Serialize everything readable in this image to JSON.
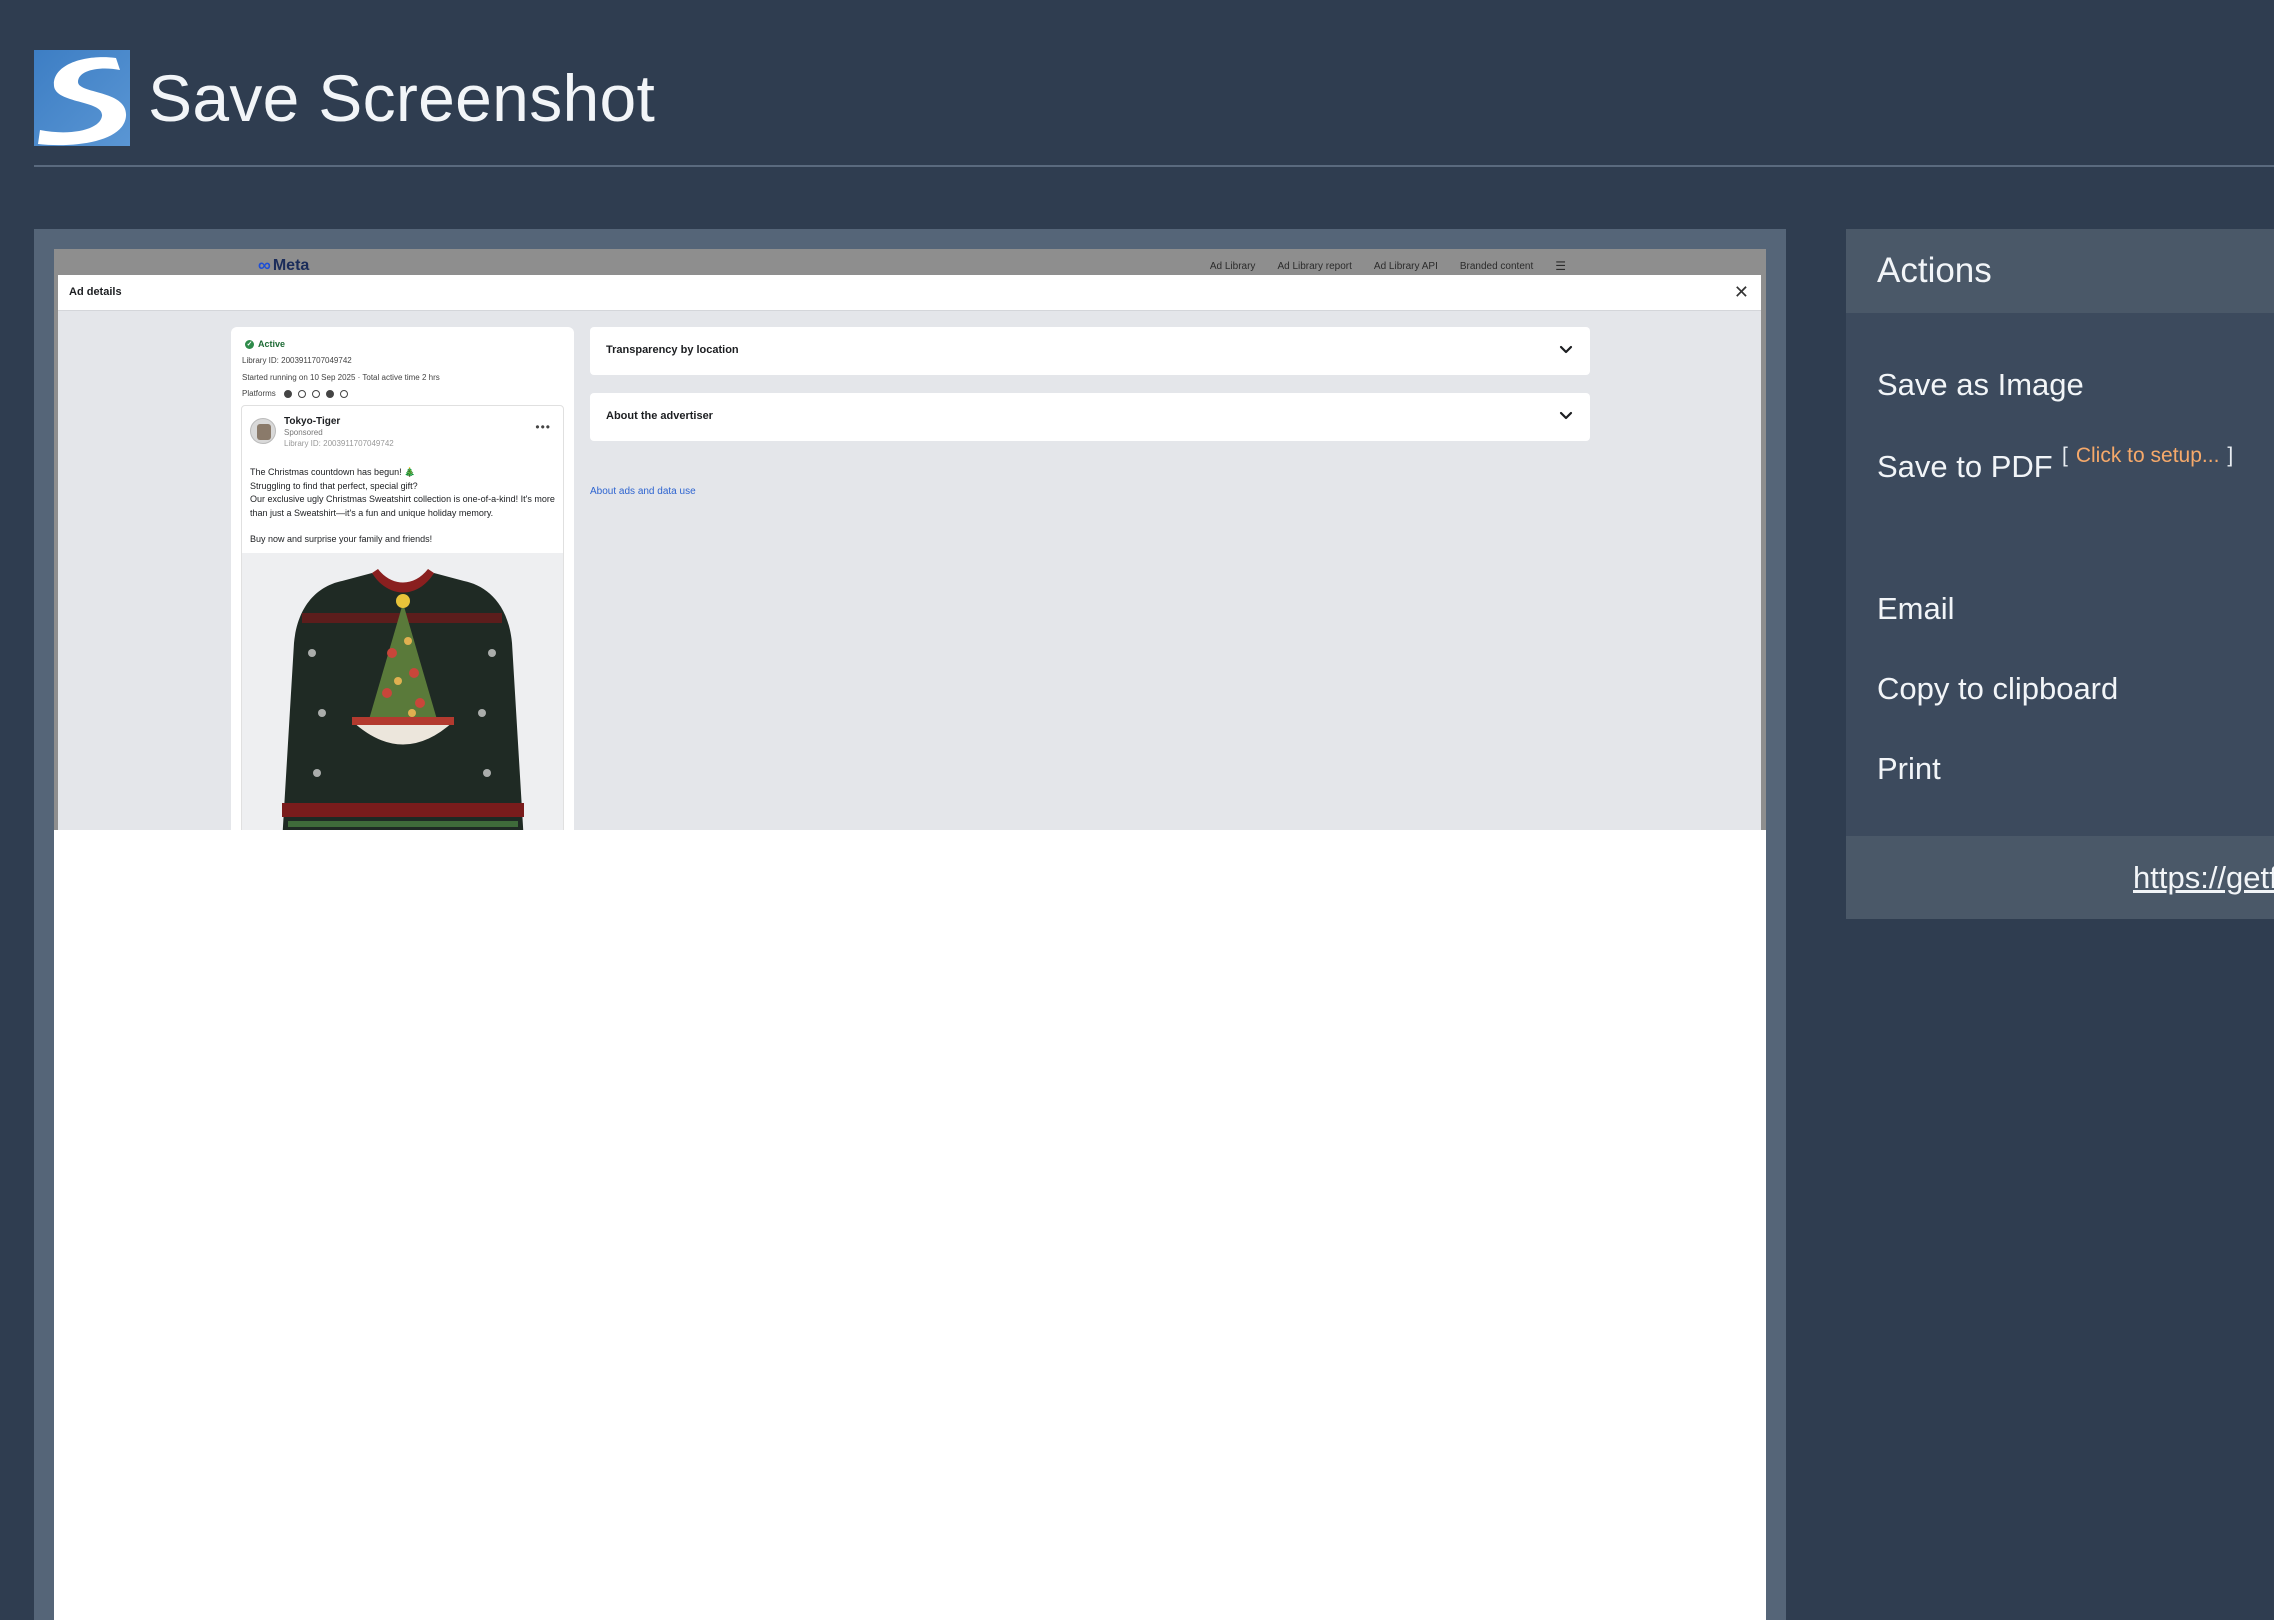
{
  "app": {
    "title": "Save Screenshot"
  },
  "preview": {
    "meta_logo": "Meta",
    "meta_nav": [
      "Ad Library",
      "Ad Library report",
      "Ad Library API",
      "Branded content"
    ],
    "dialog_title": "Ad details",
    "ad": {
      "status": "Active",
      "library_id": "Library ID: 2003911707049742",
      "started": "Started running on 10 Sep 2025 · Total active time 2 hrs",
      "platforms_label": "Platforms",
      "page_name": "Tokyo-Tiger",
      "sponsored": "Sponsored",
      "post_library_id": "Library ID: 2003911707049742",
      "body_lines": [
        "The Christmas countdown has begun! 🎄",
        "Struggling to find that perfect, special gift?",
        "Our exclusive ugly Christmas Sweatshirt collection is one-of-a-kind! It's more than just a Sweatshirt—it's a fun and unique holiday memory."
      ],
      "cta_line": "Buy now and surprise your family and friends!"
    },
    "sections": [
      "Transparency by location",
      "About the advertiser"
    ],
    "about_link": "About ads and data use"
  },
  "actions": {
    "title": "Actions",
    "save_image": "Save as Image",
    "save_pdf": "Save to PDF",
    "pdf_setup_open": "[",
    "pdf_setup_link": "Click to setup...",
    "pdf_setup_close": "]",
    "email": "Email",
    "copy": "Copy to clipboard",
    "print": "Print",
    "footer_link": "https://getf"
  },
  "colors": {
    "background": "#2f3d50",
    "panel": "#3c4a5d",
    "panel_header": "#4a5868",
    "accent_link": "#f6a96a",
    "meta_link": "#2d64d0",
    "active_green": "#2e8b4a"
  },
  "icons": {
    "app_logo": "s-logo-icon",
    "close": "close-icon",
    "chevron": "chevron-down-icon",
    "more": "more-horizontal-icon",
    "menu": "hamburger-icon"
  }
}
